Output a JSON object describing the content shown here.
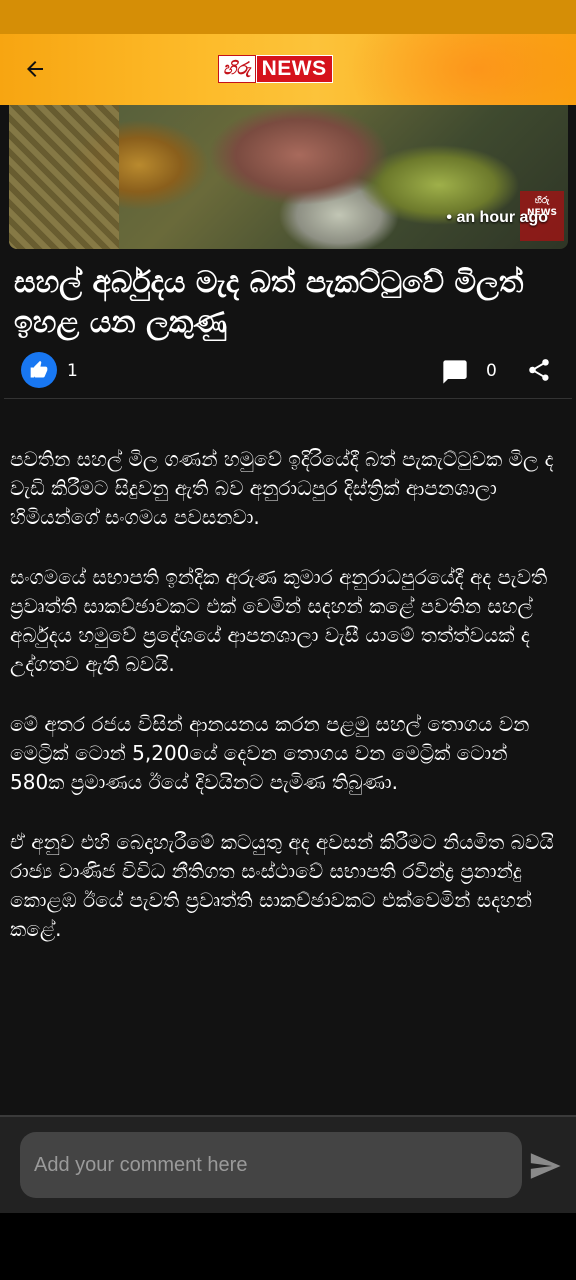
{
  "header": {
    "back_icon": "arrow-left-icon",
    "logo_hiru": "හිරු",
    "logo_news": "NEWS"
  },
  "hero": {
    "time_ago": "• an hour ago",
    "watermark": "හිරු NEWS"
  },
  "article": {
    "title": "සහල් අර්බුදය මැද බත් පැකට්ටුවේ මිලත් ඉහළ යන ලකුණු",
    "likes": "1",
    "comments": "0",
    "paragraphs": [
      "පවතින සහල් මිල ගණන් හමුවේ ඉදිරියේදී බත් පැකැට්ටුවක මිල ද වැඩි කිරීමට සිදුවනු ඇති බව අනුරාධපුර දිස්ත්‍රික් ආපනශාලා හිමියන්ගේ සංගමය පවසනවා.",
      "සංගමයේ සභාපති ඉන්දික අරුණ කුමාර අනුරාධපුරයේදී අද පැවති ප්‍රවෘත්ති සාකච්ඡාවකට එක් වෙමින් සදහන් කළේ පවතින සහල් අර්බුදය හමුවේ ප්‍රදේශයේ ආපනශාලා වැසී යාමේ තත්ත්වයක් ද උද්ගතව ඇති බවයි.",
      "මේ අතර රජය විසින් ආනයනය කරන පළමු සහල් තොගය වන මෙට්‍රික් ටොන් 5,200යේ දෙවන තොගය වන මෙට්‍රික් ටොන් 580ක ප්‍රමාණය ඊයේ දිවයිනට පැමිණ තිබුණා.",
      "ඒ අනුව එහි බෙදාහැරීමේ කටයුතු අද අවසන් කිරීමට නියමිත බවයි රාජ්‍ය වාණිජ විවිධ නීතිගත සංස්ථාවේ සභාපති රවීන්ද්‍ර ප්‍රනාන්දු කොළඹ ඊයේ පැවති ප්‍රවෘත්ති සාකච්ඡාවකට එක්වෙමින් සදහන් කළේ."
    ]
  },
  "comment_box": {
    "placeholder": "Add your comment here",
    "send_icon": "send-icon"
  },
  "colors": {
    "header": "#fcb427",
    "status_bar": "#d58e06",
    "background": "#121212",
    "like": "#1877f2"
  }
}
